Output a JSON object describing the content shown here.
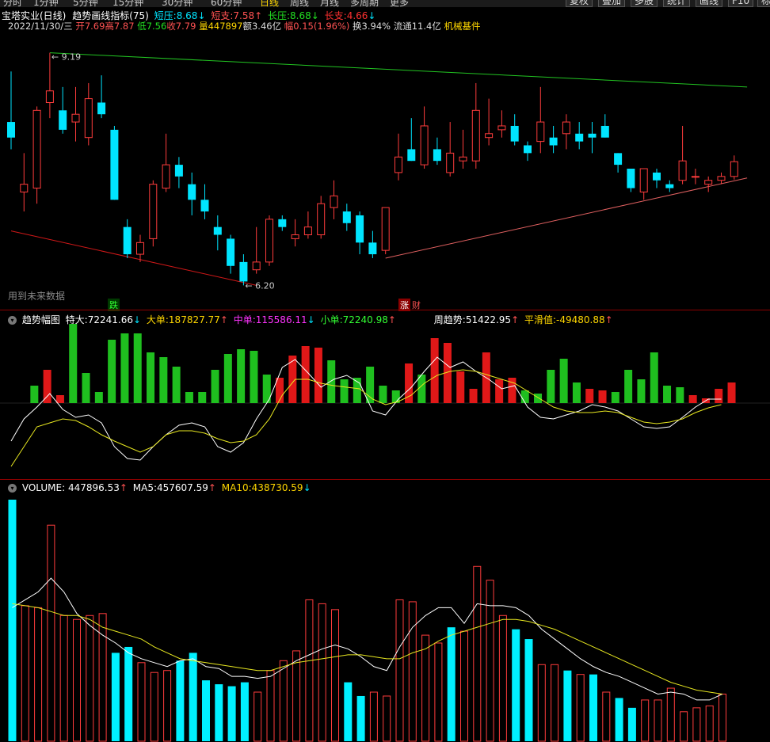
{
  "topbar": {
    "tabs": [
      "分时",
      "1分钟",
      "5分钟",
      "15分钟",
      "30分钟",
      "60分钟",
      "日线",
      "周线",
      "月线",
      "多周期",
      "更多"
    ],
    "buttons": [
      "复权",
      "叠加",
      "多股",
      "统计",
      "画线",
      "F10",
      "标记"
    ]
  },
  "header": {
    "stock": "宝塔实业(日线)",
    "indicator": "趋势画线指标(75)",
    "short_pressure_label": "短压:",
    "short_pressure": "8.68",
    "short_support_label": "短支:",
    "short_support": "7.58",
    "long_pressure_label": "长压:",
    "long_pressure": "8.68",
    "long_support_label": "长支:",
    "long_support": "4.66",
    "date": "2022/11/30/三",
    "open": "开7.69",
    "high": "高7.87",
    "low": "低7.56",
    "close": "收7.79",
    "volume": "量447897",
    "amount": "额3.46亿",
    "change": "幅0.15(1.96%)",
    "turnover": "换3.94%",
    "float": "流通11.4亿",
    "sector": "机械基件"
  },
  "main_chart": {
    "future_label": "用到未来数据",
    "high_label": "9.19",
    "low_label": "6.20",
    "mark_down": "跌",
    "mark_up": "涨",
    "mark_fin": "财"
  },
  "trend_panel": {
    "title": "趋势幅图",
    "special_label": "特大:",
    "special": "72241.66",
    "large_label": "大单:",
    "large": "187827.77",
    "medium_label": "中单:",
    "medium": "115586.11",
    "small_label": "小单:",
    "small": "72240.98",
    "week_label": "周趋势:",
    "week": "51422.95",
    "smooth_label": "平滑值:",
    "smooth": "-49480.88"
  },
  "volume_panel": {
    "title": "VOLUME:",
    "volume": "447896.53",
    "ma5_label": "MA5:",
    "ma5": "457607.59",
    "ma10_label": "MA10:",
    "ma10": "438730.59"
  },
  "chart_data": [
    {
      "type": "candlestick",
      "title": "宝塔实业(日线)",
      "ylim": [
        6.0,
        9.4
      ],
      "candles": [
        {
          "o": 8.1,
          "h": 8.95,
          "l": 7.95,
          "c": 8.3,
          "up": false
        },
        {
          "o": 7.4,
          "h": 7.9,
          "l": 7.15,
          "c": 7.5,
          "up": true
        },
        {
          "o": 7.45,
          "h": 8.5,
          "l": 7.25,
          "c": 8.45,
          "up": true
        },
        {
          "o": 8.55,
          "h": 9.19,
          "l": 8.35,
          "c": 8.7,
          "up": true
        },
        {
          "o": 8.45,
          "h": 8.75,
          "l": 8.15,
          "c": 8.2,
          "up": false
        },
        {
          "o": 8.3,
          "h": 8.75,
          "l": 8.05,
          "c": 8.4,
          "up": true
        },
        {
          "o": 8.1,
          "h": 8.8,
          "l": 8.0,
          "c": 8.6,
          "up": true
        },
        {
          "o": 8.55,
          "h": 8.9,
          "l": 8.35,
          "c": 8.4,
          "up": false
        },
        {
          "o": 8.2,
          "h": 8.25,
          "l": 7.3,
          "c": 7.3,
          "up": false
        },
        {
          "o": 6.95,
          "h": 7.05,
          "l": 6.55,
          "c": 6.6,
          "up": false
        },
        {
          "o": 6.6,
          "h": 6.85,
          "l": 6.5,
          "c": 6.75,
          "up": true
        },
        {
          "o": 6.8,
          "h": 7.55,
          "l": 6.7,
          "c": 7.5,
          "up": true
        },
        {
          "o": 7.45,
          "h": 8.15,
          "l": 7.4,
          "c": 7.75,
          "up": true
        },
        {
          "o": 7.75,
          "h": 7.85,
          "l": 7.45,
          "c": 7.6,
          "up": false
        },
        {
          "o": 7.5,
          "h": 7.65,
          "l": 7.1,
          "c": 7.3,
          "up": false
        },
        {
          "o": 7.3,
          "h": 7.5,
          "l": 7.05,
          "c": 7.15,
          "up": false
        },
        {
          "o": 6.95,
          "h": 7.1,
          "l": 6.65,
          "c": 6.85,
          "up": false
        },
        {
          "o": 6.8,
          "h": 6.85,
          "l": 6.35,
          "c": 6.45,
          "up": false
        },
        {
          "o": 6.5,
          "h": 6.6,
          "l": 6.2,
          "c": 6.25,
          "up": false
        },
        {
          "o": 6.4,
          "h": 6.95,
          "l": 6.35,
          "c": 6.5,
          "up": true
        },
        {
          "o": 6.5,
          "h": 7.1,
          "l": 6.45,
          "c": 7.05,
          "up": true
        },
        {
          "o": 7.05,
          "h": 7.1,
          "l": 6.9,
          "c": 6.95,
          "up": false
        },
        {
          "o": 6.8,
          "h": 7.05,
          "l": 6.7,
          "c": 6.85,
          "up": true
        },
        {
          "o": 6.85,
          "h": 7.15,
          "l": 6.8,
          "c": 6.95,
          "up": true
        },
        {
          "o": 6.85,
          "h": 7.35,
          "l": 6.8,
          "c": 7.25,
          "up": true
        },
        {
          "o": 7.2,
          "h": 7.55,
          "l": 7.05,
          "c": 7.35,
          "up": true
        },
        {
          "o": 7.15,
          "h": 7.25,
          "l": 6.9,
          "c": 7.0,
          "up": false
        },
        {
          "o": 7.1,
          "h": 7.15,
          "l": 6.6,
          "c": 6.75,
          "up": false
        },
        {
          "o": 6.75,
          "h": 6.9,
          "l": 6.55,
          "c": 6.6,
          "up": false
        },
        {
          "o": 6.65,
          "h": 7.2,
          "l": 6.6,
          "c": 7.2,
          "up": true
        },
        {
          "o": 7.65,
          "h": 8.15,
          "l": 7.55,
          "c": 7.85,
          "up": true
        },
        {
          "o": 7.95,
          "h": 8.35,
          "l": 7.8,
          "c": 7.8,
          "up": false
        },
        {
          "o": 7.75,
          "h": 8.5,
          "l": 7.7,
          "c": 8.25,
          "up": true
        },
        {
          "o": 7.95,
          "h": 8.1,
          "l": 7.75,
          "c": 7.8,
          "up": false
        },
        {
          "o": 7.65,
          "h": 8.3,
          "l": 7.6,
          "c": 7.9,
          "up": true
        },
        {
          "o": 7.8,
          "h": 8.2,
          "l": 7.7,
          "c": 7.85,
          "up": true
        },
        {
          "o": 7.8,
          "h": 8.8,
          "l": 7.7,
          "c": 8.45,
          "up": true
        },
        {
          "o": 8.15,
          "h": 8.6,
          "l": 8.0,
          "c": 8.1,
          "up": true
        },
        {
          "o": 8.25,
          "h": 8.45,
          "l": 8.1,
          "c": 8.2,
          "up": true
        },
        {
          "o": 8.25,
          "h": 8.4,
          "l": 8.0,
          "c": 8.05,
          "up": false
        },
        {
          "o": 7.9,
          "h": 8.05,
          "l": 7.8,
          "c": 8.0,
          "up": false
        },
        {
          "o": 8.05,
          "h": 8.75,
          "l": 7.9,
          "c": 8.3,
          "up": true
        },
        {
          "o": 8.1,
          "h": 8.25,
          "l": 7.9,
          "c": 8.0,
          "up": false
        },
        {
          "o": 8.15,
          "h": 8.4,
          "l": 7.95,
          "c": 8.3,
          "up": true
        },
        {
          "o": 8.15,
          "h": 8.3,
          "l": 7.95,
          "c": 8.05,
          "up": false
        },
        {
          "o": 8.15,
          "h": 8.3,
          "l": 7.9,
          "c": 8.1,
          "up": false
        },
        {
          "o": 8.25,
          "h": 8.4,
          "l": 8.1,
          "c": 8.1,
          "up": false
        },
        {
          "o": 7.9,
          "h": 7.9,
          "l": 7.65,
          "c": 7.75,
          "up": false
        },
        {
          "o": 7.7,
          "h": 7.7,
          "l": 7.4,
          "c": 7.45,
          "up": false
        },
        {
          "o": 7.4,
          "h": 7.7,
          "l": 7.3,
          "c": 7.7,
          "up": true
        },
        {
          "o": 7.65,
          "h": 7.7,
          "l": 7.45,
          "c": 7.55,
          "up": false
        },
        {
          "o": 7.5,
          "h": 7.55,
          "l": 7.4,
          "c": 7.45,
          "up": false
        },
        {
          "o": 7.55,
          "h": 8.25,
          "l": 7.5,
          "c": 7.8,
          "up": true
        },
        {
          "o": 7.6,
          "h": 7.7,
          "l": 7.5,
          "c": 7.6,
          "up": true
        },
        {
          "o": 7.5,
          "h": 7.6,
          "l": 7.4,
          "c": 7.55,
          "up": true
        },
        {
          "o": 7.55,
          "h": 7.65,
          "l": 7.5,
          "c": 7.6,
          "up": true
        },
        {
          "o": 7.6,
          "h": 7.87,
          "l": 7.56,
          "c": 7.79,
          "up": true
        }
      ],
      "trendlines": [
        {
          "name": "长压",
          "color": "#22c422",
          "from": [
            3,
            9.19
          ],
          "to": [
            57,
            8.75
          ]
        },
        {
          "name": "短支",
          "color": "#e06060",
          "from": [
            29,
            6.55
          ],
          "to": [
            57,
            7.58
          ]
        },
        {
          "name": "长支",
          "color": "#d01818",
          "from": [
            0,
            6.9
          ],
          "to": [
            19,
            6.2
          ]
        }
      ]
    },
    {
      "type": "bar",
      "title": "趋势幅图",
      "ylim": [
        -1,
        1
      ],
      "values": [
        0,
        0.22,
        0.42,
        0.1,
        1.0,
        0.38,
        0.14,
        0.8,
        0.88,
        0.88,
        0.64,
        0.58,
        0.46,
        0.14,
        0.14,
        0.42,
        0.62,
        0.68,
        0.66,
        0.36,
        0.32,
        0.6,
        0.72,
        0.7,
        0.54,
        0.3,
        0.32,
        0.46,
        0.22,
        0.16,
        0.5,
        0.36,
        0.82,
        0.76,
        0.4,
        0.18,
        0.64,
        0.3,
        0.32,
        0.16,
        0.12,
        0.42,
        0.56,
        0.26,
        0.18,
        0.16,
        0.14,
        0.42,
        0.3,
        0.64,
        0.22,
        0.2,
        0.1,
        0.06,
        0.18,
        0.26
      ],
      "up": [
        false,
        false,
        true,
        true,
        false,
        false,
        false,
        false,
        false,
        false,
        false,
        false,
        false,
        false,
        false,
        false,
        false,
        false,
        false,
        false,
        true,
        true,
        true,
        true,
        false,
        false,
        false,
        false,
        false,
        false,
        true,
        false,
        true,
        true,
        true,
        true,
        true,
        true,
        true,
        false,
        false,
        false,
        false,
        false,
        true,
        true,
        false,
        false,
        false,
        false,
        false,
        false,
        true,
        true,
        true,
        true
      ],
      "series": [
        {
          "name": "white",
          "values": [
            -0.48,
            -0.2,
            -0.05,
            0.12,
            -0.08,
            -0.18,
            -0.15,
            -0.25,
            -0.55,
            -0.7,
            -0.72,
            -0.55,
            -0.4,
            -0.28,
            -0.25,
            -0.3,
            -0.55,
            -0.62,
            -0.5,
            -0.2,
            0.05,
            0.45,
            0.55,
            0.38,
            0.2,
            0.3,
            0.35,
            0.25,
            -0.1,
            -0.15,
            0.05,
            0.2,
            0.4,
            0.58,
            0.45,
            0.52,
            0.4,
            0.3,
            0.18,
            0.22,
            -0.05,
            -0.18,
            -0.2,
            -0.15,
            -0.1,
            -0.02,
            -0.05,
            -0.1,
            -0.2,
            -0.3,
            -0.32,
            -0.3,
            -0.18,
            -0.05,
            0.05,
            0.05
          ]
        },
        {
          "name": "yellow",
          "values": [
            -0.8,
            -0.55,
            -0.3,
            -0.25,
            -0.2,
            -0.22,
            -0.3,
            -0.4,
            -0.48,
            -0.55,
            -0.62,
            -0.55,
            -0.4,
            -0.35,
            -0.35,
            -0.38,
            -0.45,
            -0.5,
            -0.48,
            -0.4,
            -0.2,
            0.1,
            0.3,
            0.3,
            0.25,
            0.22,
            0.2,
            0.18,
            0.05,
            -0.02,
            0.02,
            0.1,
            0.25,
            0.35,
            0.4,
            0.42,
            0.4,
            0.35,
            0.3,
            0.25,
            0.15,
            0.05,
            -0.05,
            -0.1,
            -0.12,
            -0.12,
            -0.1,
            -0.12,
            -0.18,
            -0.24,
            -0.26,
            -0.24,
            -0.2,
            -0.12,
            -0.06,
            -0.02
          ]
        }
      ]
    },
    {
      "type": "bar",
      "title": "VOLUME",
      "ylim": [
        0,
        1250000
      ],
      "values": [
        1230000,
        690000,
        680000,
        1100000,
        640000,
        620000,
        640000,
        650000,
        450000,
        480000,
        400000,
        350000,
        360000,
        410000,
        450000,
        310000,
        290000,
        280000,
        300000,
        250000,
        360000,
        410000,
        460000,
        720000,
        700000,
        670000,
        300000,
        230000,
        250000,
        230000,
        720000,
        710000,
        540000,
        500000,
        580000,
        560000,
        890000,
        820000,
        640000,
        570000,
        520000,
        390000,
        390000,
        360000,
        340000,
        340000,
        250000,
        220000,
        170000,
        210000,
        210000,
        270000,
        150000,
        170000,
        180000,
        240000
      ],
      "up": [
        false,
        true,
        true,
        true,
        true,
        true,
        true,
        true,
        false,
        false,
        true,
        true,
        true,
        false,
        false,
        false,
        false,
        false,
        false,
        true,
        true,
        true,
        true,
        true,
        true,
        true,
        false,
        false,
        true,
        true,
        true,
        true,
        true,
        true,
        false,
        true,
        true,
        true,
        true,
        false,
        false,
        true,
        true,
        false,
        true,
        false,
        true,
        false,
        false,
        true,
        true,
        true,
        true,
        true,
        true,
        true
      ],
      "series": [
        {
          "name": "MA5",
          "values": [
            680000,
            720000,
            760000,
            830000,
            760000,
            650000,
            590000,
            540000,
            500000,
            450000,
            420000,
            400000,
            380000,
            410000,
            420000,
            380000,
            370000,
            330000,
            330000,
            320000,
            330000,
            370000,
            410000,
            440000,
            470000,
            490000,
            470000,
            430000,
            380000,
            360000,
            480000,
            580000,
            640000,
            680000,
            680000,
            600000,
            700000,
            690000,
            690000,
            680000,
            640000,
            570000,
            520000,
            470000,
            420000,
            380000,
            350000,
            330000,
            300000,
            270000,
            240000,
            250000,
            240000,
            210000,
            210000,
            240000
          ]
        },
        {
          "name": "MA10",
          "values": [
            700000,
            690000,
            680000,
            660000,
            640000,
            640000,
            620000,
            580000,
            560000,
            540000,
            520000,
            480000,
            450000,
            420000,
            410000,
            400000,
            390000,
            380000,
            370000,
            360000,
            360000,
            380000,
            400000,
            410000,
            420000,
            430000,
            440000,
            440000,
            430000,
            420000,
            420000,
            450000,
            470000,
            510000,
            540000,
            560000,
            580000,
            600000,
            620000,
            620000,
            610000,
            590000,
            570000,
            540000,
            510000,
            480000,
            450000,
            420000,
            390000,
            360000,
            330000,
            300000,
            280000,
            260000,
            250000,
            240000
          ]
        }
      ]
    }
  ]
}
